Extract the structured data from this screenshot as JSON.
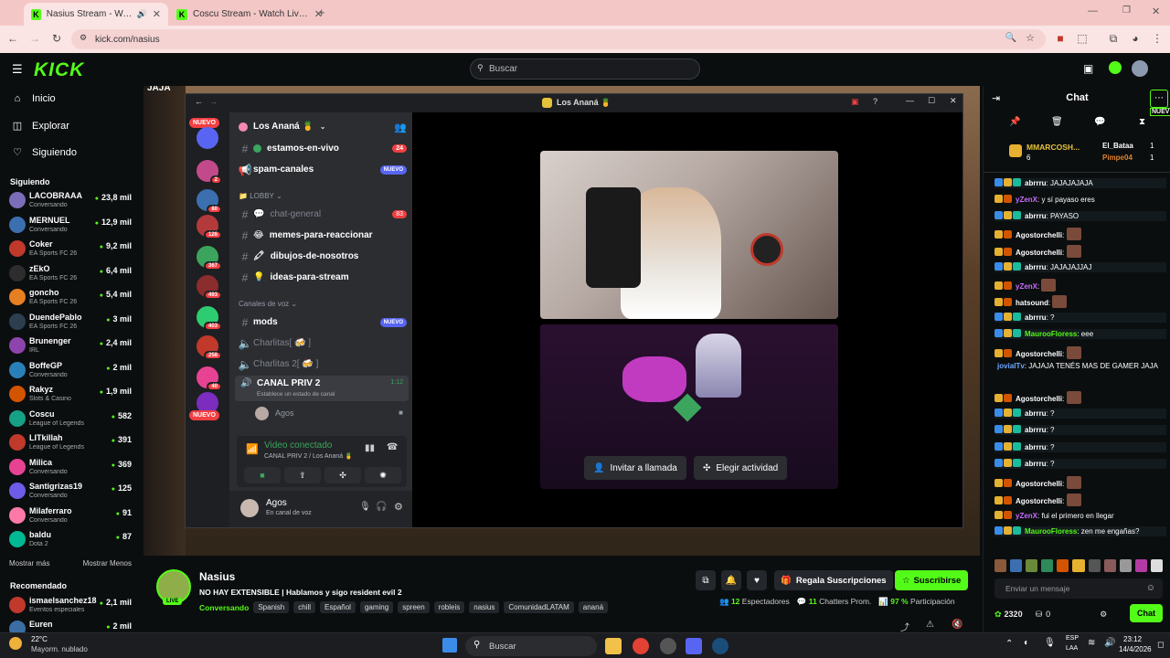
{
  "browser": {
    "tabs": [
      {
        "title": "Nasius Stream - Watch Live"
      },
      {
        "title": "Coscu Stream - Watch Live on"
      }
    ],
    "url": "kick.com/nasius"
  },
  "header": {
    "logo": "KICK",
    "search_placeholder": "Buscar"
  },
  "sidebar": {
    "nav": [
      {
        "label": "Inicio",
        "icon": "home-icon"
      },
      {
        "label": "Explorar",
        "icon": "compass-icon"
      },
      {
        "label": "Siguiendo",
        "icon": "heart-icon"
      }
    ],
    "following_title": "Siguiendo",
    "following": [
      {
        "name": "LACOBRAAA",
        "category": "Conversando",
        "viewers": "23,8 mil"
      },
      {
        "name": "MERNUEL",
        "category": "Conversando",
        "viewers": "12,9 mil"
      },
      {
        "name": "Coker",
        "category": "EA Sports FC 26",
        "viewers": "9,2 mil"
      },
      {
        "name": "zEkO",
        "category": "EA Sports FC 26",
        "viewers": "6,4 mil"
      },
      {
        "name": "goncho",
        "category": "EA Sports FC 26",
        "viewers": "5,4 mil"
      },
      {
        "name": "DuendePablo",
        "category": "EA Sports FC 26",
        "viewers": "3 mil"
      },
      {
        "name": "Brunenger",
        "category": "IRL",
        "viewers": "2,4 mil"
      },
      {
        "name": "BoffeGP",
        "category": "Conversando",
        "viewers": "2 mil"
      },
      {
        "name": "Rakyz",
        "category": "Slots & Casino",
        "viewers": "1,9 mil"
      },
      {
        "name": "Coscu",
        "category": "League of Legends",
        "viewers": "582"
      },
      {
        "name": "LITkillah",
        "category": "League of Legends",
        "viewers": "391"
      },
      {
        "name": "Milica",
        "category": "Conversando",
        "viewers": "369"
      },
      {
        "name": "Santigrizas19",
        "category": "Conversando",
        "viewers": "125"
      },
      {
        "name": "Milaferraro",
        "category": "Conversando",
        "viewers": "91"
      },
      {
        "name": "baldu",
        "category": "Dota 2",
        "viewers": "87"
      }
    ],
    "show_more": "Mostrar más",
    "show_less": "Mostrar Menos",
    "recommended_title": "Recomendado",
    "recommended": [
      {
        "name": "ismaelsanchez18",
        "category": "Eventos especiales",
        "viewers": "2,1 mil"
      },
      {
        "name": "Euren",
        "category": "",
        "viewers": "2 mil"
      }
    ]
  },
  "discord": {
    "window_title": "Los Ananá 🍍",
    "server_name": "Los Ananá 🍍",
    "guild_badges": [
      "2",
      "80",
      "126",
      "367",
      "493",
      "403",
      "258",
      "40"
    ],
    "new_pill": "NUEVO",
    "channels": [
      {
        "name": "estamos-en-vivo",
        "badge": "24"
      },
      {
        "name": "spam-canales",
        "tag": "NUEVO"
      }
    ],
    "lobby_label": "LOBBY",
    "lobby_channels": [
      {
        "name": "chat-general",
        "badge": "83"
      },
      {
        "name": "memes-para-reaccionar"
      },
      {
        "name": "dibujos-de-nosotros"
      },
      {
        "name": "ideas-para-stream"
      }
    ],
    "voice_category": "Canales de voz",
    "voice_channels": [
      {
        "name": "mods",
        "tag": "NUEVO"
      },
      {
        "name": "Charlitas[ 🍻 ]"
      },
      {
        "name": "Charlitas 2[ 🍻 ]"
      }
    ],
    "active_channel": {
      "name": "CANAL PRIV 2",
      "status": "Establece un estado de canal",
      "time": "1:12",
      "member": "Agos"
    },
    "voice_panel": {
      "status": "Video conectado",
      "location": "CANAL PRIV 2 / Los Ananá 🍍"
    },
    "user": {
      "name": "Agos",
      "status": "En canal de voz"
    },
    "buttons": {
      "invite": "Invitar a llamada",
      "activity": "Elegir actividad"
    }
  },
  "stream": {
    "streamer": "Nasius",
    "live_label": "LIVE",
    "title": "NO HAY EXTENSIBLE | Hablamos y sigo resident evil 2",
    "category": "Conversando",
    "tags": [
      "Spanish",
      "chill",
      "Español",
      "gaming",
      "spreen",
      "robleis",
      "nasius",
      "ComunidadLATAM",
      "ananá"
    ],
    "gift_label": "Regala Suscripciones",
    "subscribe_label": "Suscribirse",
    "stats": {
      "viewers": "12",
      "viewers_label": "Espectadores",
      "chatters": "11",
      "chatters_label": "Chatters Prom.",
      "participation": "97 %",
      "participation_label": "Participación"
    }
  },
  "chat": {
    "title": "Chat",
    "new_tag": "NUEV",
    "pinned": [
      {
        "user": "MMARCOSH...",
        "count": "6"
      },
      {
        "user": "El_Bataa",
        "count": "1"
      },
      {
        "user": "Pimpe04",
        "count": "1"
      }
    ],
    "messages": [
      {
        "user": "abrrru",
        "color": "#ffffff",
        "text": "JAJAJAJAJA"
      },
      {
        "user": "yZenX",
        "color": "#c86cff",
        "text": "y sí payaso eres"
      },
      {
        "user": "abrrru",
        "color": "#ffffff",
        "text": "PAYASO"
      },
      {
        "user": "Agostorchelli",
        "color": "#ffffff",
        "text": ""
      },
      {
        "user": "Agostorchelli",
        "color": "#ffffff",
        "text": ""
      },
      {
        "user": "abrrru",
        "color": "#ffffff",
        "text": "JAJAJAJJAJ"
      },
      {
        "user": "yZenX",
        "color": "#c86cff",
        "text": ""
      },
      {
        "user": "hatsound",
        "color": "#ffffff",
        "text": ""
      },
      {
        "user": "abrrru",
        "color": "#ffffff",
        "text": "?"
      },
      {
        "user": "MaurooFloress",
        "color": "#53fc18",
        "text": "eee"
      },
      {
        "user": "Agostorchelli",
        "color": "#ffffff",
        "text": ""
      },
      {
        "user": "jovialTv",
        "color": "#6ca8ff",
        "text": "JAJAJA TENÉS MAS DE GAMER JAJA"
      },
      {
        "user": "Agostorchelli",
        "color": "#ffffff",
        "text": ""
      },
      {
        "user": "abrrru",
        "color": "#ffffff",
        "text": "?"
      },
      {
        "user": "abrrru",
        "color": "#ffffff",
        "text": "?"
      },
      {
        "user": "abrrru",
        "color": "#ffffff",
        "text": "?"
      },
      {
        "user": "abrrru",
        "color": "#ffffff",
        "text": "?"
      },
      {
        "user": "Agostorchelli",
        "color": "#ffffff",
        "text": ""
      },
      {
        "user": "Agostorchelli",
        "color": "#ffffff",
        "text": ""
      },
      {
        "user": "yZenX",
        "color": "#c86cff",
        "text": "fui el primero en llegar"
      },
      {
        "user": "MaurooFloress",
        "color": "#53fc18",
        "text": "zen me engañas?"
      }
    ],
    "input_placeholder": "Enviar un mensaje",
    "points": "2320",
    "points_other": "0",
    "send_label": "Chat"
  },
  "stream_overlay_text": "JAJA",
  "taskbar": {
    "weather_temp": "22°C",
    "weather_desc": "Mayorm. nublado",
    "search_placeholder": "Buscar",
    "lang_1": "ESP",
    "lang_2": "LAA",
    "time": "23:12",
    "date": "14/4/2026"
  },
  "colors": {
    "kick_green": "#53fc18",
    "discord_blurple": "#5865f2",
    "discord_red": "#f23f42"
  }
}
